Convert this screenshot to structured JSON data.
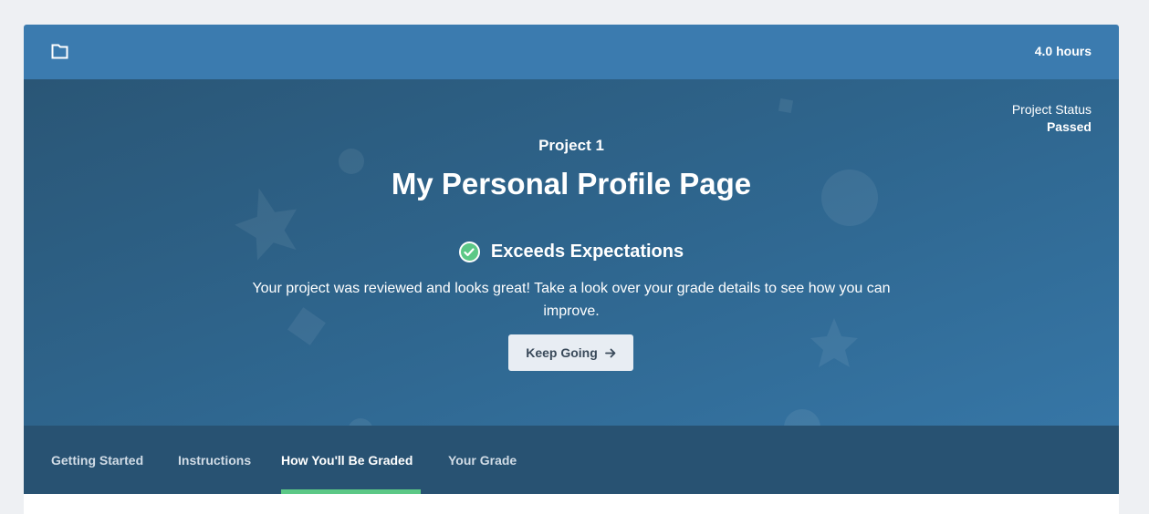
{
  "header": {
    "folder_icon": "folder-icon",
    "hours": "4.0 hours"
  },
  "hero": {
    "status_label": "Project Status",
    "status_value": "Passed",
    "project_label": "Project 1",
    "title": "My Personal Profile Page",
    "grade_icon": "check-circle-icon",
    "grade": "Exceeds Expectations",
    "description": "Your project was reviewed and looks great! Take a look over your grade details to see how you can improve.",
    "button_label": "Keep Going"
  },
  "tabs": [
    {
      "label": "Getting Started",
      "active": false
    },
    {
      "label": "Instructions",
      "active": false
    },
    {
      "label": "How You'll Be Graded",
      "active": true
    },
    {
      "label": "Your Grade",
      "active": false
    }
  ],
  "colors": {
    "topbar": "#3b7baf",
    "hero": "#2f6790",
    "tabbar": "#285272",
    "accent_green": "#5cc886",
    "button_bg": "#e8edf3"
  }
}
